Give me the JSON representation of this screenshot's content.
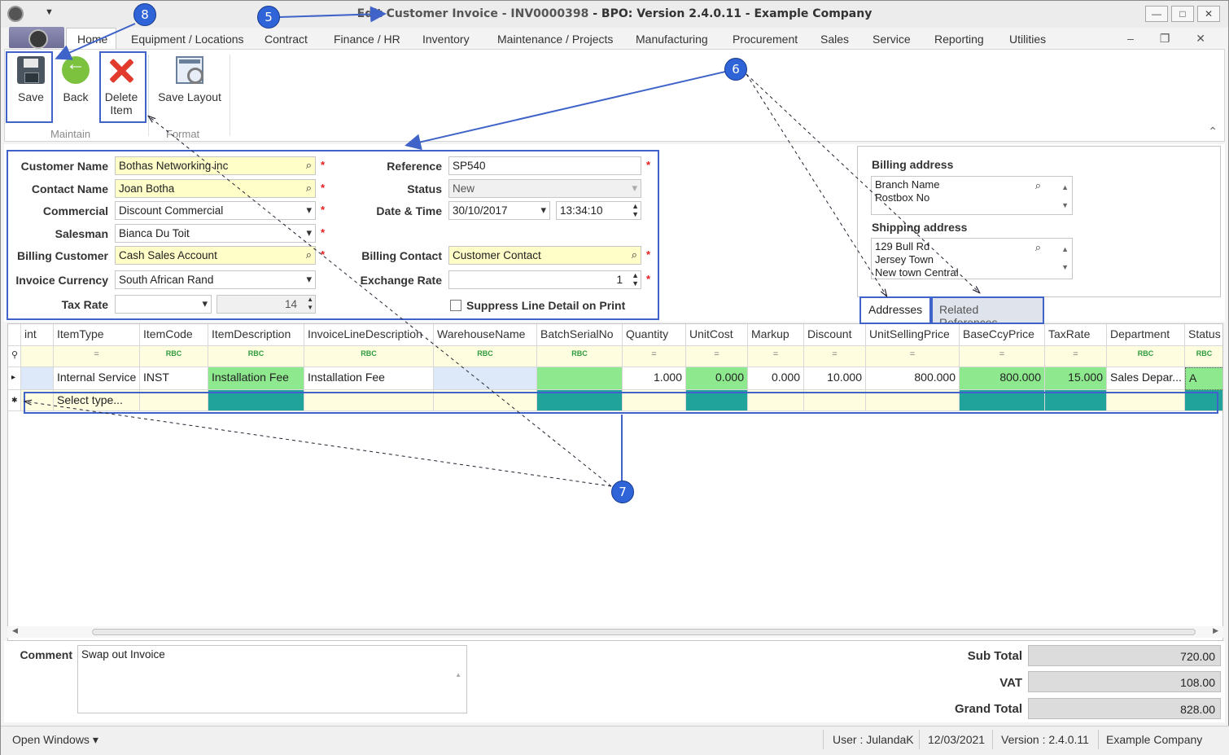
{
  "window": {
    "title_prefix": "Edit Customer Invoice - INV0000398",
    "title_suffix": " - BPO: Version 2.4.0.11 - Example Company",
    "buttons": [
      "—",
      "□",
      "✕"
    ]
  },
  "menu": {
    "quick_access": "▼",
    "tabs": [
      "Home",
      "Equipment / Locations",
      "Contract",
      "Finance / HR",
      "Inventory",
      "Maintenance / Projects",
      "Manufacturing",
      "Procurement",
      "Sales",
      "Service",
      "Reporting",
      "Utilities"
    ],
    "mdi_buttons": "– ❐ ✕"
  },
  "ribbon": {
    "save": "Save",
    "back": "Back",
    "delete_line1": "Delete",
    "delete_line2": "Item",
    "save_layout": "Save Layout",
    "group_maintain": "Maintain",
    "group_format": "Format",
    "collapse": "⌃"
  },
  "form": {
    "customer_name_label": "Customer Name",
    "customer_name": "Bothas Networking inc",
    "contact_name_label": "Contact Name",
    "contact_name": "Joan Botha",
    "commercial_label": "Commercial",
    "commercial": "Discount Commercial",
    "salesman_label": "Salesman",
    "salesman": "Bianca Du Toit",
    "billing_customer_label": "Billing Customer",
    "billing_customer": "Cash Sales Account",
    "invoice_currency_label": "Invoice Currency",
    "invoice_currency": "South African Rand",
    "tax_rate_label": "Tax Rate",
    "tax_rate": "",
    "tax_rate_value": "14",
    "reference_label": "Reference",
    "reference": "SP540",
    "status_label": "Status",
    "status": "New",
    "date_time_label": "Date & Time",
    "date": "30/10/2017",
    "time": "13:34:10",
    "billing_contact_label": "Billing Contact",
    "billing_contact": "Customer Contact",
    "exchange_rate_label": "Exchange Rate",
    "exchange_rate": "1",
    "suppress_label": "Suppress Line Detail on Print",
    "required_mark": "*"
  },
  "addresses": {
    "billing_title": "Billing address",
    "billing_lines": [
      "Branch Name",
      "Postbox No"
    ],
    "shipping_title": "Shipping address",
    "shipping_lines": [
      "129 Bull Rd",
      "Jersey Town",
      "New town Central"
    ],
    "tab_addresses": "Addresses",
    "tab_related": "Related References"
  },
  "grid": {
    "columns": [
      "int",
      "ItemType",
      "ItemCode",
      "ItemDescription",
      "InvoiceLineDescription",
      "WarehouseName",
      "BatchSerialNo",
      "Quantity",
      "UnitCost",
      "Markup",
      "Discount",
      "UnitSellingPrice",
      "BaseCcyPrice",
      "TaxRate",
      "Department",
      "Status"
    ],
    "filter_eq": "=",
    "filter_abc": "RBC",
    "row": [
      "",
      "Internal Service",
      "INST",
      "Installation Fee",
      "Installation Fee",
      "",
      "",
      "1.000",
      "0.000",
      "0.000",
      "10.000",
      "800.000",
      "800.000",
      "15.000",
      "Sales Depar...",
      "A"
    ],
    "new_row_text": "Select type...",
    "row_marker": "▸",
    "new_marker": "✱",
    "filter_marker": "⚲"
  },
  "bottom": {
    "comment_label": "Comment",
    "comment": "Swap out Invoice",
    "subtotal_label": "Sub Total",
    "subtotal": "720.00",
    "vat_label": "VAT",
    "vat": "108.00",
    "grand_total_label": "Grand Total",
    "grand_total": "828.00"
  },
  "statusbar": {
    "open_windows": "Open Windows ▾",
    "user": "User : JulandaK",
    "date": "12/03/2021",
    "version": "Version : 2.4.0.11",
    "company": "Example Company"
  },
  "callouts": [
    "5",
    "6",
    "7",
    "8"
  ],
  "colors": {
    "highlight": "#3f63c8",
    "callout": "#2f63d8",
    "required_field": "#fffdc8",
    "grid_green": "#8ee88e",
    "grid_teal": "#1fa39a"
  }
}
